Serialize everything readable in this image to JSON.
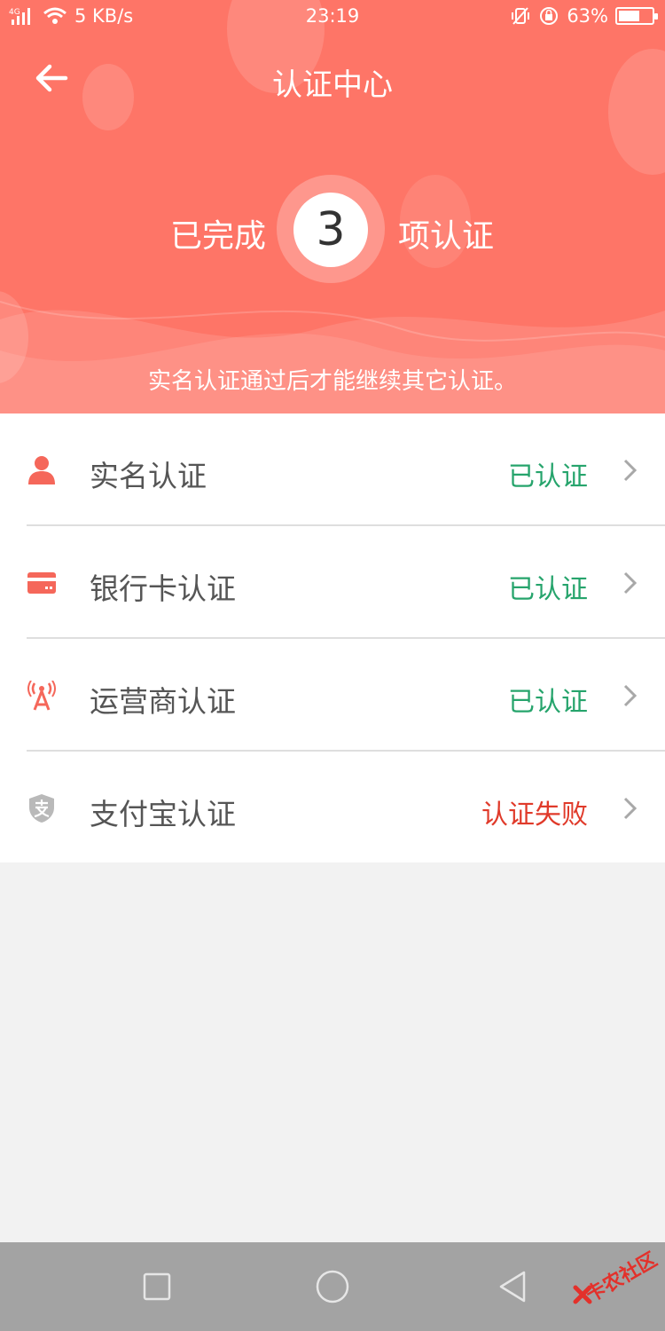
{
  "status_bar": {
    "network": "4G",
    "speed": "5 KB/s",
    "time": "23:19",
    "battery": "63%",
    "battery_level": 0.63
  },
  "header": {
    "title": "认证中心",
    "count_prefix": "已完成",
    "count": "3",
    "count_suffix": "项认证",
    "tip": "实名认证通过后才能继续其它认证。"
  },
  "items": [
    {
      "label": "实名认证",
      "status": "已认证",
      "icon": "person-icon"
    },
    {
      "label": "银行卡认证",
      "status": "已认证",
      "icon": "bank-card-icon"
    },
    {
      "label": "运营商认证",
      "status": "已认证",
      "icon": "signal-tower-icon"
    },
    {
      "label": "支付宝认证",
      "status": "认证失败",
      "icon": "alipay-icon"
    }
  ],
  "watermark": "卡农社区",
  "colors": {
    "header": "#fe7567",
    "verified": "#26a46c",
    "failed": "#e03a2a",
    "icon_red": "#f5675a",
    "icon_grey": "#b9b9b9"
  }
}
